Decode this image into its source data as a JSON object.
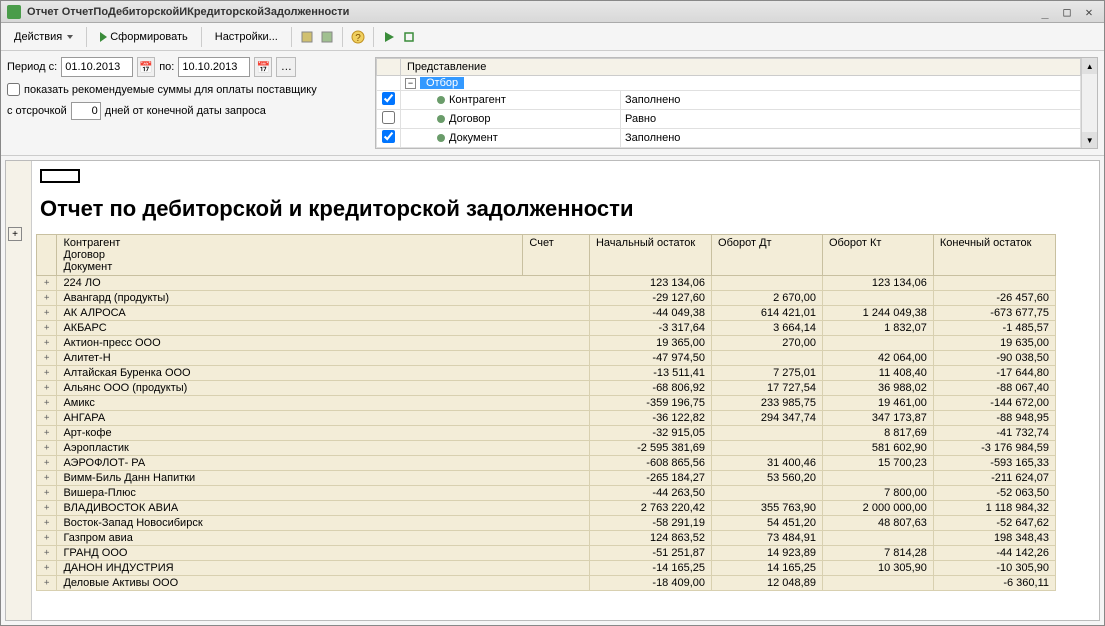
{
  "window": {
    "title": "Отчет  ОтчетПоДебиторскойИКредиторскойЗадолженности"
  },
  "toolbar": {
    "actions": "Действия",
    "form": "Сформировать",
    "settings": "Настройки..."
  },
  "filters": {
    "period_from_label": "Период с:",
    "period_from": "01.10.2013",
    "period_to_label": "по:",
    "period_to": "10.10.2013",
    "show_recommended": "показать рекомендуемые суммы для оплаты поставщику",
    "with_delay": "с отсрочкой",
    "days": "0",
    "days_suffix": "дней от конечной даты запроса"
  },
  "selection": {
    "header": "Представление",
    "root": "Отбор",
    "rows": [
      {
        "checked": true,
        "name": "Контрагент",
        "cond": "Заполнено"
      },
      {
        "checked": false,
        "name": "Договор",
        "cond": "Равно"
      },
      {
        "checked": true,
        "name": "Документ",
        "cond": "Заполнено"
      }
    ]
  },
  "report": {
    "title": "Отчет по дебиторской и кредиторской задолженности",
    "headers": {
      "counterparty": "Контрагент",
      "contract": "Договор",
      "document": "Документ",
      "account": "Счет",
      "start_balance": "Начальный остаток",
      "turnover_dt": "Оборот Дт",
      "turnover_kt": "Оборот Кт",
      "end_balance": "Конечный остаток"
    }
  },
  "chart_data": {
    "type": "table",
    "columns": [
      "Контрагент",
      "Начальный остаток",
      "Оборот Дт",
      "Оборот Кт",
      "Конечный остаток"
    ],
    "rows": [
      {
        "name": "224 ЛО",
        "start": "123 134,06",
        "dt": "",
        "kt": "123 134,06",
        "end": ""
      },
      {
        "name": "Авангард (продукты)",
        "start": "-29 127,60",
        "dt": "2 670,00",
        "kt": "",
        "end": "-26 457,60"
      },
      {
        "name": "АК АЛРОСА",
        "start": "-44 049,38",
        "dt": "614 421,01",
        "kt": "1 244 049,38",
        "end": "-673 677,75"
      },
      {
        "name": "АКБАРС",
        "start": "-3 317,64",
        "dt": "3 664,14",
        "kt": "1 832,07",
        "end": "-1 485,57"
      },
      {
        "name": "Актион-пресс ООО",
        "start": "19 365,00",
        "dt": "270,00",
        "kt": "",
        "end": "19 635,00"
      },
      {
        "name": "Алитет-Н",
        "start": "-47 974,50",
        "dt": "",
        "kt": "42 064,00",
        "end": "-90 038,50"
      },
      {
        "name": "Алтайская Буренка ООО",
        "start": "-13 511,41",
        "dt": "7 275,01",
        "kt": "11 408,40",
        "end": "-17 644,80"
      },
      {
        "name": "Альянс ООО (продукты)",
        "start": "-68 806,92",
        "dt": "17 727,54",
        "kt": "36 988,02",
        "end": "-88 067,40"
      },
      {
        "name": "Амикс",
        "start": "-359 196,75",
        "dt": "233 985,75",
        "kt": "19 461,00",
        "end": "-144 672,00"
      },
      {
        "name": "АНГАРА",
        "start": "-36 122,82",
        "dt": "294 347,74",
        "kt": "347 173,87",
        "end": "-88 948,95"
      },
      {
        "name": "Арт-кофе",
        "start": "-32 915,05",
        "dt": "",
        "kt": "8 817,69",
        "end": "-41 732,74"
      },
      {
        "name": "Аэропластик",
        "start": "-2 595 381,69",
        "dt": "",
        "kt": "581 602,90",
        "end": "-3 176 984,59"
      },
      {
        "name": "АЭРОФЛОТ- РА",
        "start": "-608 865,56",
        "dt": "31 400,46",
        "kt": "15 700,23",
        "end": "-593 165,33"
      },
      {
        "name": "Вимм-Биль Данн Напитки",
        "start": "-265 184,27",
        "dt": "53 560,20",
        "kt": "",
        "end": "-211 624,07"
      },
      {
        "name": "Вишера-Плюс",
        "start": "-44 263,50",
        "dt": "",
        "kt": "7 800,00",
        "end": "-52 063,50"
      },
      {
        "name": "ВЛАДИВОСТОК АВИА",
        "start": "2 763 220,42",
        "dt": "355 763,90",
        "kt": "2 000 000,00",
        "end": "1 118 984,32"
      },
      {
        "name": "Восток-Запад Новосибирск",
        "start": "-58 291,19",
        "dt": "54 451,20",
        "kt": "48 807,63",
        "end": "-52 647,62"
      },
      {
        "name": "Газпром  авиа",
        "start": "124 863,52",
        "dt": "73 484,91",
        "kt": "",
        "end": "198 348,43"
      },
      {
        "name": "ГРАНД  ООО",
        "start": "-51 251,87",
        "dt": "14 923,89",
        "kt": "7 814,28",
        "end": "-44 142,26"
      },
      {
        "name": "ДАНОН ИНДУСТРИЯ",
        "start": "-14 165,25",
        "dt": "14 165,25",
        "kt": "10 305,90",
        "end": "-10 305,90"
      },
      {
        "name": "Деловые Активы ООО",
        "start": "-18 409,00",
        "dt": "12 048,89",
        "kt": "",
        "end": "-6 360,11"
      }
    ]
  }
}
